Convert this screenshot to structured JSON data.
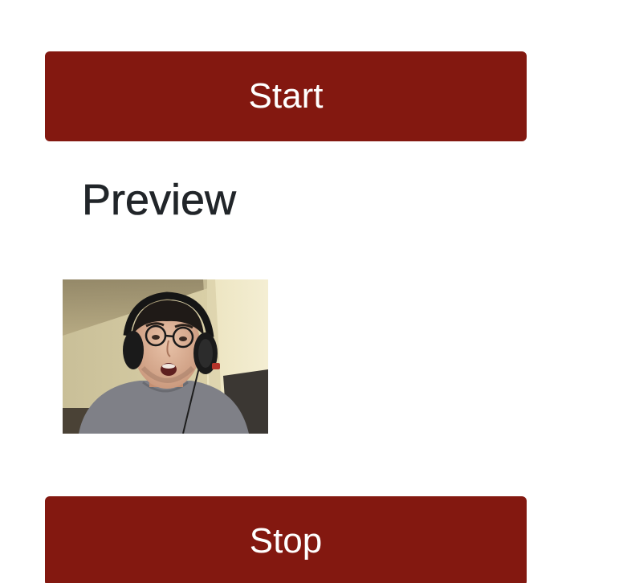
{
  "controls": {
    "start_label": "Start",
    "stop_label": "Stop"
  },
  "preview": {
    "title": "Preview"
  },
  "colors": {
    "button_bg": "#831810",
    "button_text": "#ffffff",
    "heading_text": "#212529"
  }
}
